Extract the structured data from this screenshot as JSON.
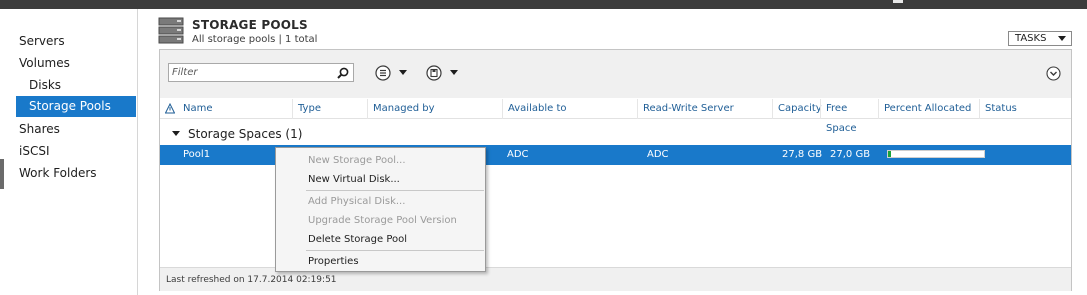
{
  "header": {
    "title": "STORAGE POOLS",
    "subtitle": "All storage pools | 1 total",
    "tasks_label": "TASKS"
  },
  "sidebar": {
    "items": [
      {
        "label": "Servers"
      },
      {
        "label": "Volumes"
      },
      {
        "label": "Disks"
      },
      {
        "label": "Storage Pools"
      },
      {
        "label": "Shares"
      },
      {
        "label": "iSCSI"
      },
      {
        "label": "Work Folders"
      }
    ],
    "selected": "Storage Pools"
  },
  "toolbar": {
    "filter_placeholder": "Filter",
    "icons": [
      "search-icon",
      "list-view-icon",
      "save-query-icon",
      "expand-icon"
    ]
  },
  "table": {
    "columns": [
      "Name",
      "Type",
      "Managed by",
      "Available to",
      "Read-Write Server",
      "Capacity",
      "Free Space",
      "Percent Allocated",
      "Status"
    ],
    "group": "Storage Spaces (1)",
    "rows": [
      {
        "name": "Pool1",
        "type": "",
        "managed_by": "",
        "available_to": "ADC",
        "read_write_server": "ADC",
        "capacity": "27,8 GB",
        "free_space": "27,0 GB",
        "percent_allocated": 0.03,
        "status": ""
      }
    ]
  },
  "footer": {
    "refreshed": "Last refreshed on 17.7.2014 02:19:51"
  },
  "context_menu": {
    "items": [
      {
        "label": "New Storage Pool...",
        "enabled": false
      },
      {
        "label": "New Virtual Disk...",
        "enabled": true
      },
      {
        "label": "Add Physical Disk...",
        "enabled": false
      },
      {
        "label": "Upgrade Storage Pool Version",
        "enabled": false
      },
      {
        "label": "Delete Storage Pool",
        "enabled": true
      },
      {
        "label": "Properties",
        "enabled": true
      }
    ]
  },
  "colors": {
    "selection": "#1979ca",
    "header_text": "#1f5e96",
    "allocated_bar": "#1aa33a"
  }
}
